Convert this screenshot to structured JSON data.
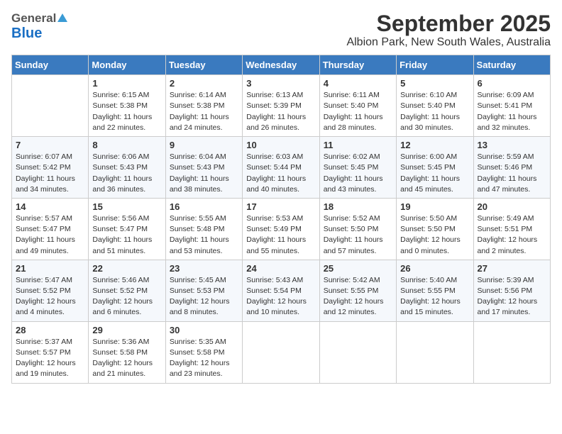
{
  "logo": {
    "general": "General",
    "blue": "Blue",
    "tagline": ""
  },
  "title": "September 2025",
  "subtitle": "Albion Park, New South Wales, Australia",
  "columns": [
    "Sunday",
    "Monday",
    "Tuesday",
    "Wednesday",
    "Thursday",
    "Friday",
    "Saturday"
  ],
  "weeks": [
    [
      {
        "day": "",
        "info": ""
      },
      {
        "day": "1",
        "info": "Sunrise: 6:15 AM\nSunset: 5:38 PM\nDaylight: 11 hours\nand 22 minutes."
      },
      {
        "day": "2",
        "info": "Sunrise: 6:14 AM\nSunset: 5:38 PM\nDaylight: 11 hours\nand 24 minutes."
      },
      {
        "day": "3",
        "info": "Sunrise: 6:13 AM\nSunset: 5:39 PM\nDaylight: 11 hours\nand 26 minutes."
      },
      {
        "day": "4",
        "info": "Sunrise: 6:11 AM\nSunset: 5:40 PM\nDaylight: 11 hours\nand 28 minutes."
      },
      {
        "day": "5",
        "info": "Sunrise: 6:10 AM\nSunset: 5:40 PM\nDaylight: 11 hours\nand 30 minutes."
      },
      {
        "day": "6",
        "info": "Sunrise: 6:09 AM\nSunset: 5:41 PM\nDaylight: 11 hours\nand 32 minutes."
      }
    ],
    [
      {
        "day": "7",
        "info": "Sunrise: 6:07 AM\nSunset: 5:42 PM\nDaylight: 11 hours\nand 34 minutes."
      },
      {
        "day": "8",
        "info": "Sunrise: 6:06 AM\nSunset: 5:43 PM\nDaylight: 11 hours\nand 36 minutes."
      },
      {
        "day": "9",
        "info": "Sunrise: 6:04 AM\nSunset: 5:43 PM\nDaylight: 11 hours\nand 38 minutes."
      },
      {
        "day": "10",
        "info": "Sunrise: 6:03 AM\nSunset: 5:44 PM\nDaylight: 11 hours\nand 40 minutes."
      },
      {
        "day": "11",
        "info": "Sunrise: 6:02 AM\nSunset: 5:45 PM\nDaylight: 11 hours\nand 43 minutes."
      },
      {
        "day": "12",
        "info": "Sunrise: 6:00 AM\nSunset: 5:45 PM\nDaylight: 11 hours\nand 45 minutes."
      },
      {
        "day": "13",
        "info": "Sunrise: 5:59 AM\nSunset: 5:46 PM\nDaylight: 11 hours\nand 47 minutes."
      }
    ],
    [
      {
        "day": "14",
        "info": "Sunrise: 5:57 AM\nSunset: 5:47 PM\nDaylight: 11 hours\nand 49 minutes."
      },
      {
        "day": "15",
        "info": "Sunrise: 5:56 AM\nSunset: 5:47 PM\nDaylight: 11 hours\nand 51 minutes."
      },
      {
        "day": "16",
        "info": "Sunrise: 5:55 AM\nSunset: 5:48 PM\nDaylight: 11 hours\nand 53 minutes."
      },
      {
        "day": "17",
        "info": "Sunrise: 5:53 AM\nSunset: 5:49 PM\nDaylight: 11 hours\nand 55 minutes."
      },
      {
        "day": "18",
        "info": "Sunrise: 5:52 AM\nSunset: 5:50 PM\nDaylight: 11 hours\nand 57 minutes."
      },
      {
        "day": "19",
        "info": "Sunrise: 5:50 AM\nSunset: 5:50 PM\nDaylight: 12 hours\nand 0 minutes."
      },
      {
        "day": "20",
        "info": "Sunrise: 5:49 AM\nSunset: 5:51 PM\nDaylight: 12 hours\nand 2 minutes."
      }
    ],
    [
      {
        "day": "21",
        "info": "Sunrise: 5:47 AM\nSunset: 5:52 PM\nDaylight: 12 hours\nand 4 minutes."
      },
      {
        "day": "22",
        "info": "Sunrise: 5:46 AM\nSunset: 5:52 PM\nDaylight: 12 hours\nand 6 minutes."
      },
      {
        "day": "23",
        "info": "Sunrise: 5:45 AM\nSunset: 5:53 PM\nDaylight: 12 hours\nand 8 minutes."
      },
      {
        "day": "24",
        "info": "Sunrise: 5:43 AM\nSunset: 5:54 PM\nDaylight: 12 hours\nand 10 minutes."
      },
      {
        "day": "25",
        "info": "Sunrise: 5:42 AM\nSunset: 5:55 PM\nDaylight: 12 hours\nand 12 minutes."
      },
      {
        "day": "26",
        "info": "Sunrise: 5:40 AM\nSunset: 5:55 PM\nDaylight: 12 hours\nand 15 minutes."
      },
      {
        "day": "27",
        "info": "Sunrise: 5:39 AM\nSunset: 5:56 PM\nDaylight: 12 hours\nand 17 minutes."
      }
    ],
    [
      {
        "day": "28",
        "info": "Sunrise: 5:37 AM\nSunset: 5:57 PM\nDaylight: 12 hours\nand 19 minutes."
      },
      {
        "day": "29",
        "info": "Sunrise: 5:36 AM\nSunset: 5:58 PM\nDaylight: 12 hours\nand 21 minutes."
      },
      {
        "day": "30",
        "info": "Sunrise: 5:35 AM\nSunset: 5:58 PM\nDaylight: 12 hours\nand 23 minutes."
      },
      {
        "day": "",
        "info": ""
      },
      {
        "day": "",
        "info": ""
      },
      {
        "day": "",
        "info": ""
      },
      {
        "day": "",
        "info": ""
      }
    ]
  ]
}
